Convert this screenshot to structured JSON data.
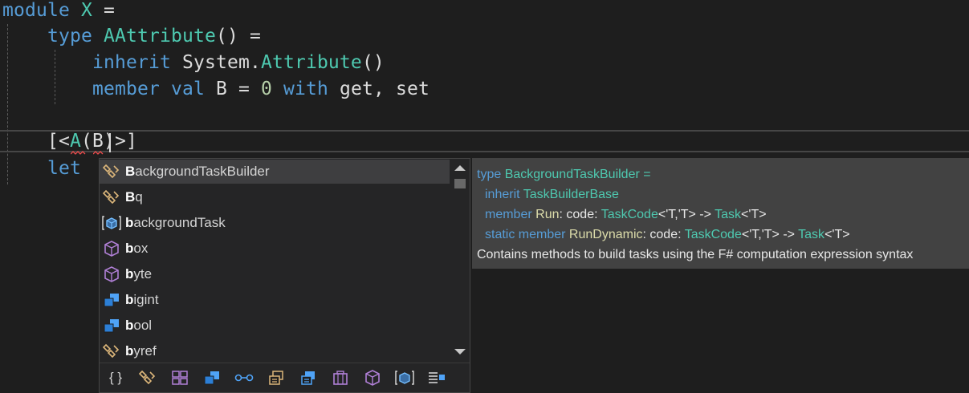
{
  "code": {
    "line1": {
      "kw": "module",
      "name": "X",
      "eq": "="
    },
    "line2": {
      "kw": "type",
      "name": "AAttribute",
      "rest": "() ="
    },
    "line3": {
      "kw": "inherit",
      "ns": "System",
      "dot": ".",
      "ty": "Attribute",
      "rest": "()"
    },
    "line4": {
      "kw1": "member",
      "kw2": "val",
      "name": "B",
      "eq": "=",
      "num": "0",
      "kw3": "with",
      "rest": "get, set"
    },
    "line6": {
      "open": "[<",
      "attr": "A",
      "paren": "(",
      "arg": "B",
      "close": ")>]"
    },
    "line7": {
      "kw": "let"
    }
  },
  "completion": {
    "items": [
      {
        "bold": "B",
        "rest": "ackgroundTaskBuilder",
        "icon": "type-icon"
      },
      {
        "bold": "B",
        "rest": "q",
        "icon": "type-icon"
      },
      {
        "bold": "b",
        "rest": "ackgroundTask",
        "icon": "method-icon"
      },
      {
        "bold": "b",
        "rest": "ox",
        "icon": "value-icon"
      },
      {
        "bold": "b",
        "rest": "yte",
        "icon": "value-icon"
      },
      {
        "bold": "b",
        "rest": "igint",
        "icon": "class-icon"
      },
      {
        "bold": "b",
        "rest": "ool",
        "icon": "class-icon"
      },
      {
        "bold": "b",
        "rest": "yref",
        "icon": "type-icon"
      }
    ],
    "filters": [
      {
        "icon": "namespace-filter-icon",
        "glyph": "{ }"
      },
      {
        "icon": "type-filter-icon"
      },
      {
        "icon": "module-filter-icon"
      },
      {
        "icon": "class-filter-icon"
      },
      {
        "icon": "interface-filter-icon"
      },
      {
        "icon": "enum-filter-icon"
      },
      {
        "icon": "structure-filter-icon"
      },
      {
        "icon": "delegate-filter-icon"
      },
      {
        "icon": "value-filter-icon"
      },
      {
        "icon": "method-filter-icon"
      },
      {
        "icon": "field-filter-icon"
      }
    ]
  },
  "tooltip": {
    "l1": {
      "kw": "type",
      "ty": "BackgroundTaskBuilder",
      "rest": " ="
    },
    "l2": {
      "kw": "inherit",
      "ty": "TaskBuilderBase"
    },
    "l3": {
      "kw": "member",
      "m": "Run",
      "p1": ": code: ",
      "t1": "TaskCode",
      "g1": "<'T,'T> -> ",
      "t2": "Task",
      "g2": "<'T>"
    },
    "l4": {
      "kw": "static member",
      "m": "RunDynamic",
      "p1": ": code: ",
      "t1": "TaskCode",
      "g1": "<'T,'T> -> ",
      "t2": "Task",
      "g2": "<'T>"
    },
    "l5": "Contains methods to build tasks using the F# computation expression syntax"
  }
}
